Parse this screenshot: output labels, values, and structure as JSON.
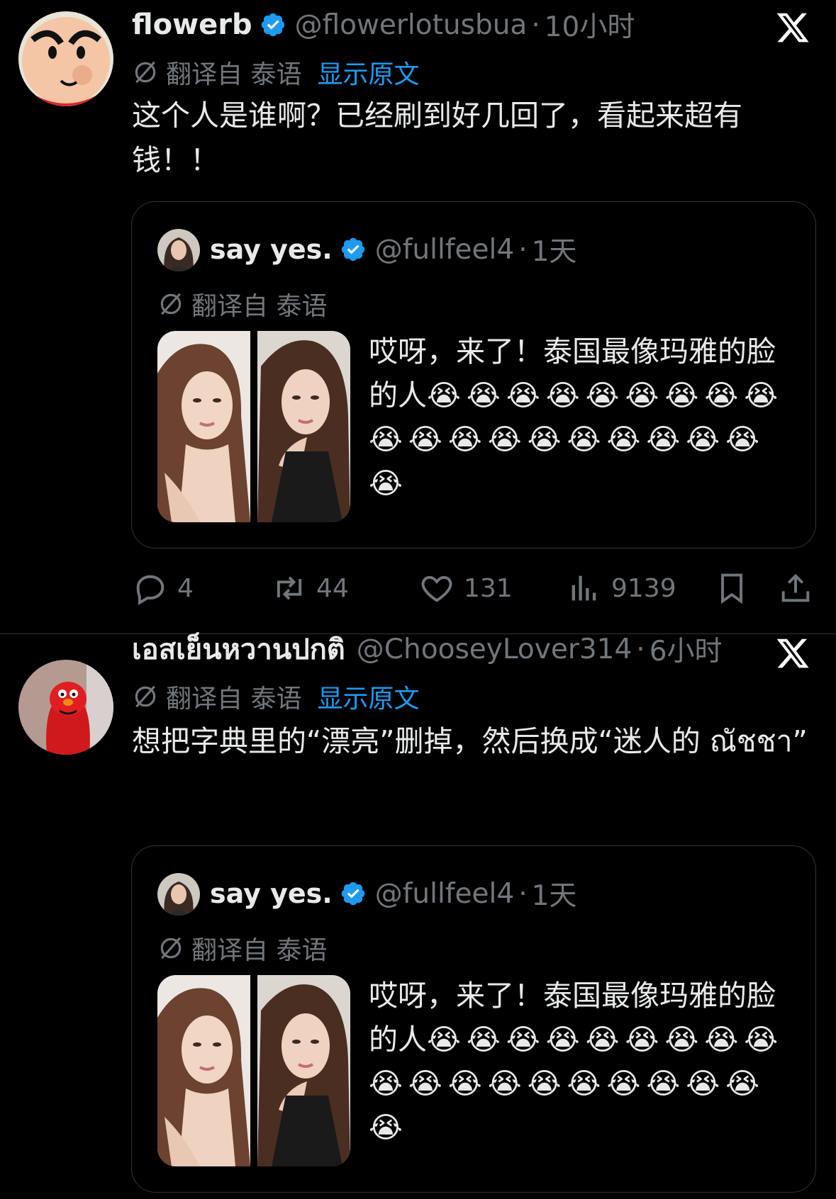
{
  "tweets": [
    {
      "name": "flowerb",
      "handle": "@flowerlotusbua",
      "sep": "·",
      "time": "10小时",
      "translated_from": "翻译自 泰语",
      "show_original": "显示原文",
      "text": "这个人是谁啊？已经刷到好几回了，看起来超有钱！！",
      "quote": {
        "name": "say yes.",
        "handle": "@fullfeel4",
        "sep": "·",
        "time": "1天",
        "translated_from": "翻译自 泰语",
        "text": "哎呀，来了！泰国最像玛雅的脸的人",
        "emoji": "😭😭😭😭😭😭😭😭😭😭😭😭😭😭😭😭😭😭😭😭"
      },
      "actions": {
        "reply_count": "4",
        "retweet_count": "44",
        "like_count": "131",
        "view_count": "9139"
      }
    },
    {
      "name": "เอสเย็นหวานปกติ",
      "handle": "@ChooseyLover314",
      "sep": "·",
      "time": "6小时",
      "translated_from": "翻译自 泰语",
      "show_original": "显示原文",
      "text": "想把字典里的“漂亮”删掉，然后换成“迷人的 ณัชชา”",
      "quote": {
        "name": "say yes.",
        "handle": "@fullfeel4",
        "sep": "·",
        "time": "1天",
        "translated_from": "翻译自 泰语",
        "text": "哎呀，来了！泰国最像玛雅的脸的人",
        "emoji": "😭😭😭😭😭😭😭😭😭😭😭😭😭😭😭😭😭😭😭😭"
      }
    }
  ],
  "icons": {
    "verified": "verified-badge-icon",
    "x_logo": "x-logo-icon",
    "translate": "translate-icon",
    "reply": "reply-icon",
    "retweet": "retweet-icon",
    "like": "heart-icon",
    "views": "views-icon",
    "bookmark": "bookmark-icon",
    "share": "share-icon"
  },
  "colors": {
    "background": "#000000",
    "text": "#e7e9ea",
    "muted": "#71767b",
    "accent": "#1d9bf0",
    "border": "#2f3336"
  }
}
